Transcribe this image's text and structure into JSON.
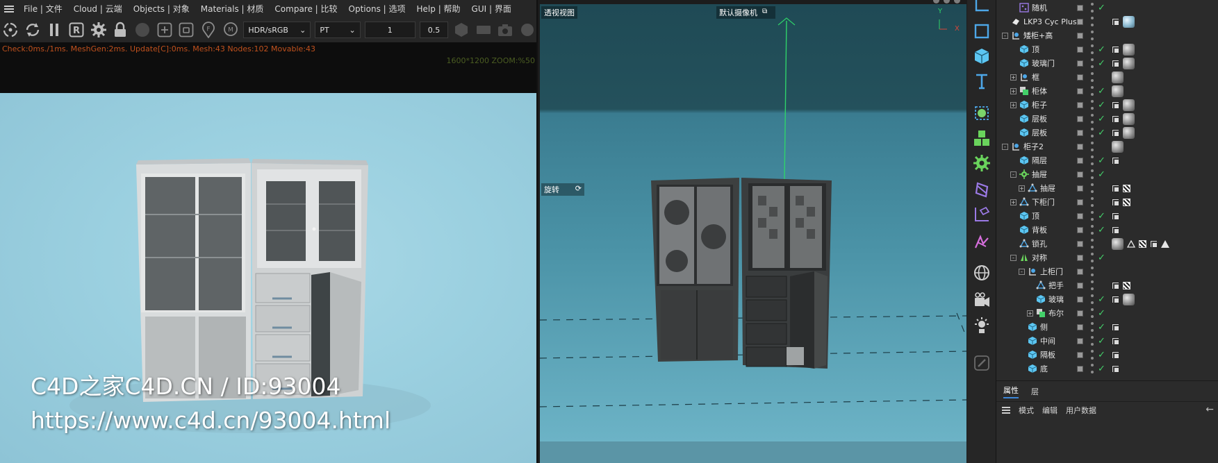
{
  "menubar": {
    "items": [
      "File | 文件",
      "Cloud | 云端",
      "Objects | 对象",
      "Materials | 材质",
      "Compare | 比较",
      "Options | 选项",
      "Help | 帮助",
      "GUI | 界面"
    ]
  },
  "toolbar": {
    "color_space": "HDR/sRGB",
    "render_mode": "PT",
    "value_a": "1",
    "value_b": "0.5"
  },
  "stats": {
    "line": "Check:0ms./1ms. MeshGen:2ms. Update[C]:0ms. Mesh:43 Nodes:102 Movable:43",
    "zoom": "1600*1200 ZOOM:%50"
  },
  "watermark": {
    "line1": "C4D之家C4D.CN / ID:93004",
    "line2": "https://www.c4d.cn/93004.html"
  },
  "viewport": {
    "view_name": "透视视图",
    "camera": "默认摄像机",
    "rotate_label": "旋转",
    "axis_y": "Y",
    "axis_x": "X"
  },
  "object_manager": {
    "rows": [
      {
        "name": "随机",
        "icon": "random-icon",
        "indent": 1,
        "toggle": "",
        "check": true,
        "tags": []
      },
      {
        "name": "LKP3 Cyc Plus",
        "icon": "plugin-icon",
        "indent": 0,
        "toggle": "",
        "check": false,
        "tags": [
          "phong",
          "glass"
        ]
      },
      {
        "name": "矮柜+高",
        "icon": "null-icon",
        "indent": 0,
        "toggle": "-",
        "check": false,
        "tags": []
      },
      {
        "name": "顶",
        "icon": "cube-icon",
        "indent": 1,
        "toggle": "",
        "check": true,
        "tags": [
          "phong",
          "mat"
        ]
      },
      {
        "name": "玻璃门",
        "icon": "cube-icon",
        "indent": 1,
        "toggle": "",
        "check": true,
        "tags": [
          "phong",
          "mat"
        ]
      },
      {
        "name": "框",
        "icon": "null-icon",
        "indent": 1,
        "toggle": "+",
        "check": false,
        "tags": [
          "mat"
        ]
      },
      {
        "name": "柜体",
        "icon": "boole-icon",
        "indent": 1,
        "toggle": "+",
        "check": true,
        "tags": [
          "mat"
        ]
      },
      {
        "name": "柜子",
        "icon": "cube-icon",
        "indent": 1,
        "toggle": "+",
        "check": true,
        "tags": [
          "phong",
          "mat"
        ]
      },
      {
        "name": "层板",
        "icon": "cube-icon",
        "indent": 1,
        "toggle": "",
        "check": true,
        "tags": [
          "phong",
          "mat"
        ]
      },
      {
        "name": "层板",
        "icon": "cube-icon",
        "indent": 1,
        "toggle": "",
        "check": true,
        "tags": [
          "phong",
          "mat"
        ]
      },
      {
        "name": "柜子2",
        "icon": "null-icon",
        "indent": 0,
        "toggle": "-",
        "check": false,
        "tags": [
          "mat"
        ]
      },
      {
        "name": "隔层",
        "icon": "cube-icon",
        "indent": 1,
        "toggle": "",
        "check": true,
        "tags": [
          "phong"
        ]
      },
      {
        "name": "抽屉",
        "icon": "cloner-icon",
        "indent": 1,
        "toggle": "-",
        "check": true,
        "tags": []
      },
      {
        "name": "抽屉",
        "icon": "poly-icon",
        "indent": 2,
        "toggle": "+",
        "check": false,
        "tags": [
          "phong",
          "checker"
        ]
      },
      {
        "name": "下柜门",
        "icon": "poly-icon",
        "indent": 1,
        "toggle": "+",
        "check": false,
        "tags": [
          "phong",
          "checker"
        ]
      },
      {
        "name": "顶",
        "icon": "cube-icon",
        "indent": 1,
        "toggle": "",
        "check": true,
        "tags": [
          "phong"
        ]
      },
      {
        "name": "背板",
        "icon": "cube-icon",
        "indent": 1,
        "toggle": "",
        "check": true,
        "tags": [
          "phong"
        ]
      },
      {
        "name": "锁孔",
        "icon": "poly-icon",
        "indent": 1,
        "toggle": "",
        "check": false,
        "tags": [
          "mat",
          "tri-outline",
          "checker",
          "phong",
          "tri"
        ]
      },
      {
        "name": "对称",
        "icon": "symmetry-icon",
        "indent": 1,
        "toggle": "-",
        "check": true,
        "tags": []
      },
      {
        "name": "上柜门",
        "icon": "null-icon",
        "indent": 2,
        "toggle": "-",
        "check": false,
        "tags": []
      },
      {
        "name": "把手",
        "icon": "poly-icon",
        "indent": 3,
        "toggle": "",
        "check": false,
        "tags": [
          "phong",
          "checker"
        ]
      },
      {
        "name": "玻璃",
        "icon": "cube-icon",
        "indent": 3,
        "toggle": "",
        "check": true,
        "tags": [
          "phong",
          "mat"
        ]
      },
      {
        "name": "布尔",
        "icon": "boole-icon",
        "indent": 3,
        "toggle": "+",
        "check": true,
        "tags": []
      },
      {
        "name": "侧",
        "icon": "cube-icon",
        "indent": 2,
        "toggle": "",
        "check": true,
        "tags": [
          "phong"
        ]
      },
      {
        "name": "中间",
        "icon": "cube-icon",
        "indent": 2,
        "toggle": "",
        "check": true,
        "tags": [
          "phong"
        ]
      },
      {
        "name": "隔板",
        "icon": "cube-icon",
        "indent": 2,
        "toggle": "",
        "check": true,
        "tags": [
          "phong"
        ]
      },
      {
        "name": "底",
        "icon": "cube-icon",
        "indent": 2,
        "toggle": "",
        "check": true,
        "tags": [
          "phong"
        ]
      }
    ]
  },
  "attributes": {
    "tabs": [
      "属性",
      "层"
    ],
    "menu": [
      "模式",
      "编辑",
      "用户数据"
    ]
  },
  "colors": {
    "accent": "#3c87d8",
    "check": "#44d06a",
    "cube_icon": "#5cc6f2",
    "stats_text": "#c0511d"
  }
}
